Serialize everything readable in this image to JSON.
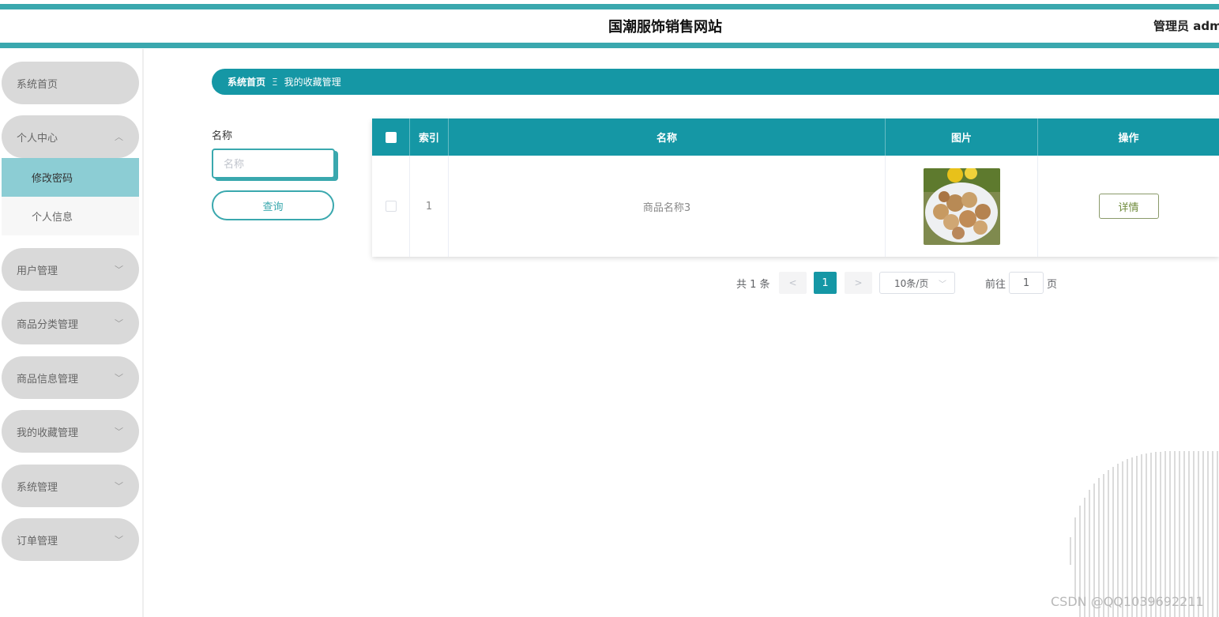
{
  "header": {
    "site_title": "国潮服饰销售网站",
    "user_label": "管理员 adm"
  },
  "sidebar": {
    "items": [
      {
        "label": "系统首页"
      },
      {
        "label": "个人中心",
        "expanded": true,
        "children": [
          {
            "label": "修改密码",
            "active": true
          },
          {
            "label": "个人信息"
          }
        ]
      },
      {
        "label": "用户管理"
      },
      {
        "label": "商品分类管理"
      },
      {
        "label": "商品信息管理"
      },
      {
        "label": "我的收藏管理"
      },
      {
        "label": "系统管理"
      },
      {
        "label": "订单管理"
      }
    ],
    "chevron_up": "︿",
    "chevron_down": "﹀"
  },
  "breadcrumb": {
    "home": "系统首页",
    "separator": "Ξ",
    "current": "我的收藏管理"
  },
  "search": {
    "label": "名称",
    "placeholder": "名称",
    "value": "",
    "button": "查询"
  },
  "table": {
    "columns": [
      "",
      "索引",
      "名称",
      "图片",
      "操作"
    ],
    "rows": [
      {
        "index": "1",
        "name": "商品名称3",
        "image": "dried-fruit-photo",
        "action": "详情"
      }
    ]
  },
  "pagination": {
    "total_text": "共 1 条",
    "prev": "<",
    "next": ">",
    "current_page": "1",
    "page_size": "10条/页",
    "goto_label": "前往",
    "goto_value": "1",
    "goto_unit": "页"
  },
  "watermark": "CSDN @QQ1039692211",
  "colors": {
    "primary": "#1597a5",
    "accent": "#3aa8ae",
    "menu_bg": "#d9d9d9",
    "submenu_active": "#8ccdd4"
  }
}
